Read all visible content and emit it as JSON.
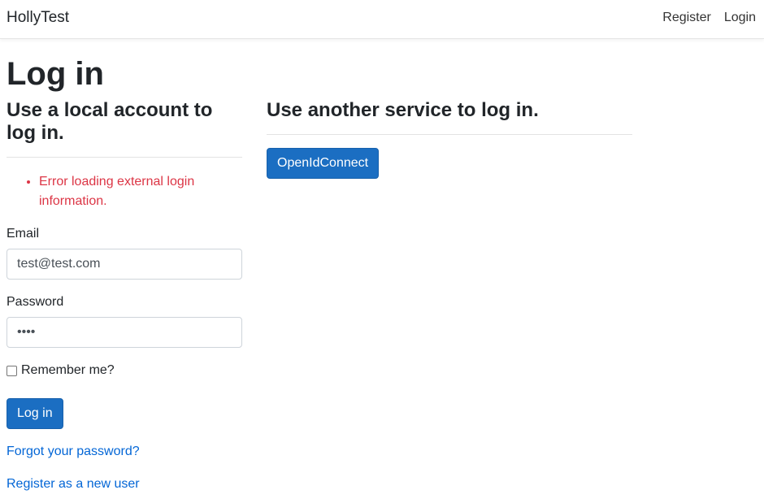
{
  "navbar": {
    "brand": "HollyTest",
    "links": [
      "Register",
      "Login"
    ]
  },
  "page": {
    "title": "Log in"
  },
  "local_login": {
    "heading": "Use a local account to log in.",
    "errors": [
      "Error loading external login information."
    ],
    "email_label": "Email",
    "email_value": "test@test.com",
    "password_label": "Password",
    "password_value": "••••",
    "remember_label": "Remember me?",
    "submit_label": "Log in",
    "forgot_link": "Forgot your password?",
    "register_link": "Register as a new user"
  },
  "external_login": {
    "heading": "Use another service to log in.",
    "providers": [
      "OpenIdConnect"
    ]
  },
  "colors": {
    "primary": "#1b6ec2",
    "link": "#0366d6",
    "error": "#dc3545"
  }
}
